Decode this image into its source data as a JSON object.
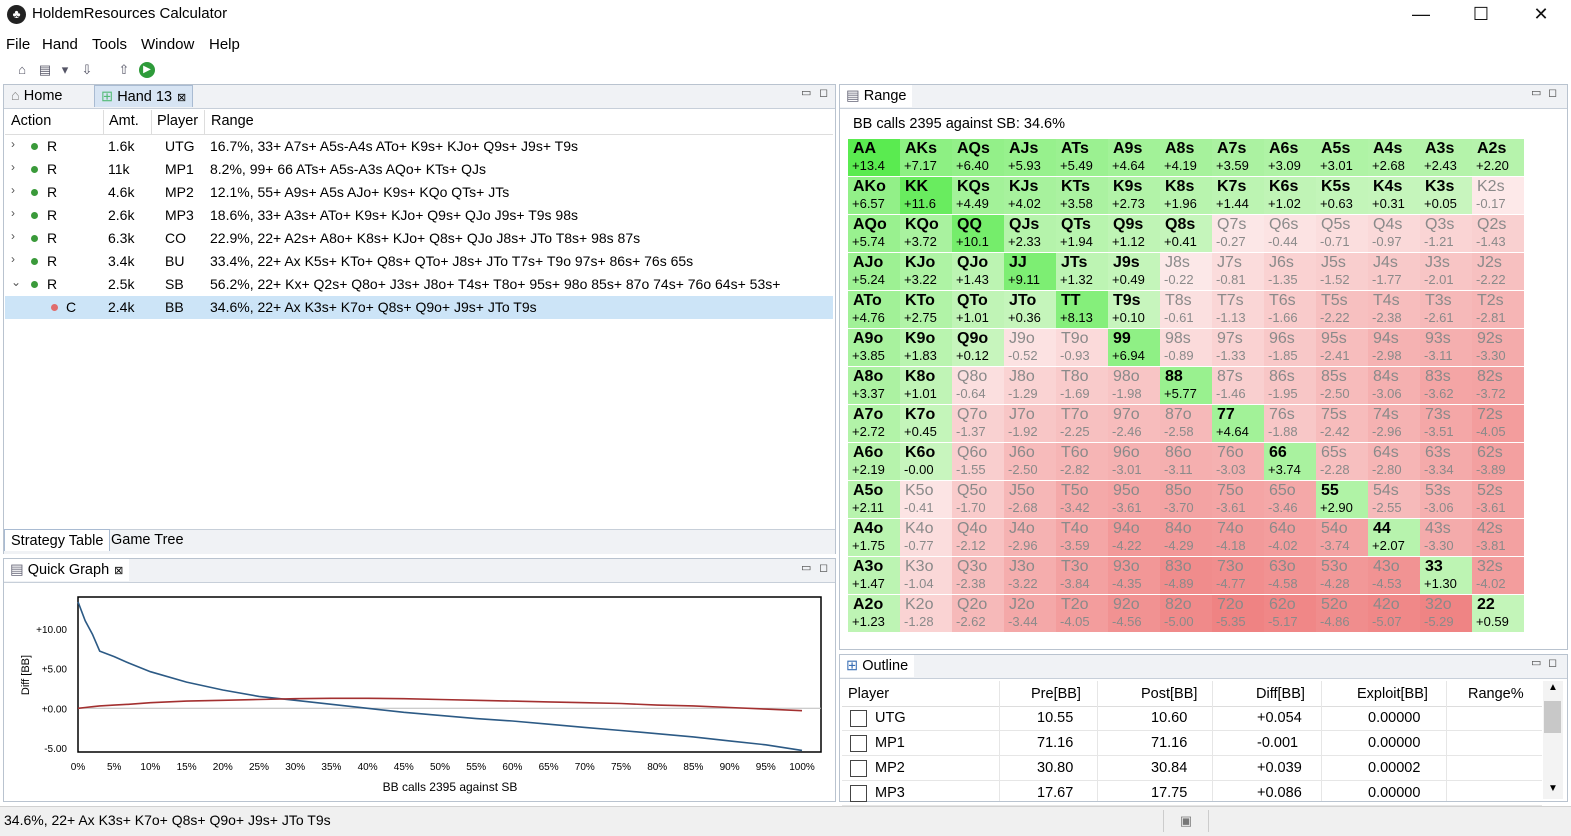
{
  "window": {
    "title": "HoldemResources Calculator"
  },
  "menu": [
    "File",
    "Hand",
    "Tools",
    "Window",
    "Help"
  ],
  "tabs": {
    "home": "Home",
    "hand": "Hand 13"
  },
  "strategy": {
    "columns": [
      "Action",
      "Amt.",
      "Player",
      "Range"
    ],
    "rows": [
      {
        "action": "R",
        "amt": "1.6k",
        "player": "UTG",
        "range": "16.7%, 33+ A7s+ A5s-A4s ATo+ K9s+ KJo+ Q9s+ J9s+ T9s"
      },
      {
        "action": "R",
        "amt": "11k",
        "player": "MP1",
        "range": "8.2%, 99+ 66 ATs+ A5s-A3s AQo+ KTs+ QJs"
      },
      {
        "action": "R",
        "amt": "4.6k",
        "player": "MP2",
        "range": "12.1%, 55+ A9s+ A5s AJo+ K9s+ KQo QTs+ JTs"
      },
      {
        "action": "R",
        "amt": "2.6k",
        "player": "MP3",
        "range": "18.6%, 33+ A3s+ ATo+ K9s+ KJo+ Q9s+ QJo J9s+ T9s 98s"
      },
      {
        "action": "R",
        "amt": "6.3k",
        "player": "CO",
        "range": "22.9%, 22+ A2s+ A8o+ K8s+ KJo+ Q8s+ QJo J8s+ JTo T8s+ 98s 87s"
      },
      {
        "action": "R",
        "amt": "3.4k",
        "player": "BU",
        "range": "33.4%, 22+ Ax K5s+ KTo+ Q8s+ QTo+ J8s+ JTo T7s+ T9o 97s+ 86s+ 76s 65s"
      },
      {
        "action": "R",
        "amt": "2.5k",
        "player": "SB",
        "range": "56.2%, 22+ Kx+ Q2s+ Q8o+ J3s+ J8o+ T4s+ T8o+ 95s+ 98o 85s+ 87o 74s+ 76o 64s+ 53s+"
      },
      {
        "action": "C",
        "amt": "2.4k",
        "player": "BB",
        "range": "34.6%, 22+ Ax K3s+ K7o+ Q8s+ Q9o+ J9s+ JTo T9s"
      }
    ],
    "bottom_tabs": [
      "Strategy Table",
      "Game Tree"
    ]
  },
  "quick_graph": {
    "tab_label": "Quick Graph",
    "ylabel": "Diff [BB]",
    "xlabel": "BB calls 2395 against SB",
    "y_ticks": [
      "+10.00",
      "+5.00",
      "+0.00",
      "-5.00"
    ],
    "x_ticks": [
      "0%",
      "5%",
      "10%",
      "15%",
      "20%",
      "25%",
      "30%",
      "35%",
      "40%",
      "45%",
      "50%",
      "55%",
      "60%",
      "65%",
      "70%",
      "75%",
      "80%",
      "85%",
      "90%",
      "95%",
      "100%"
    ]
  },
  "chart_data": {
    "type": "line",
    "xlabel": "BB calls 2395 against SB",
    "ylabel": "Diff [BB]",
    "x": [
      0,
      1,
      2,
      3,
      5,
      7,
      10,
      15,
      20,
      25,
      30,
      35,
      40,
      45,
      50,
      55,
      60,
      65,
      70,
      75,
      80,
      85,
      90,
      95,
      100
    ],
    "series": [
      {
        "color": "#2c5a85",
        "values": [
          13.4,
          11.0,
          9.3,
          7.2,
          6.5,
          5.7,
          4.6,
          3.3,
          2.3,
          1.5,
          1.0,
          0.5,
          0.0,
          -0.5,
          -0.9,
          -1.3,
          -1.6,
          -2.0,
          -2.4,
          -2.8,
          -3.2,
          -3.6,
          -4.1,
          -4.6,
          -5.3
        ]
      },
      {
        "color": "#a33030",
        "values": [
          0.0,
          0.1,
          0.2,
          0.3,
          0.4,
          0.5,
          0.7,
          0.9,
          1.0,
          1.1,
          1.2,
          1.25,
          1.25,
          1.2,
          1.1,
          1.0,
          0.9,
          0.8,
          0.7,
          0.6,
          0.4,
          0.3,
          0.1,
          -0.1,
          -0.3
        ]
      }
    ],
    "ylim": [
      -5.5,
      14
    ],
    "xlim": [
      0,
      100
    ]
  },
  "range_panel": {
    "tab_label": "Range",
    "title": "BB calls 2395 against SB: 34.6%",
    "grid": [
      [
        [
          "AA",
          "+13.4"
        ],
        [
          "AKs",
          "+7.17"
        ],
        [
          "AQs",
          "+6.40"
        ],
        [
          "AJs",
          "+5.93"
        ],
        [
          "ATs",
          "+5.49"
        ],
        [
          "A9s",
          "+4.64"
        ],
        [
          "A8s",
          "+4.19"
        ],
        [
          "A7s",
          "+3.59"
        ],
        [
          "A6s",
          "+3.09"
        ],
        [
          "A5s",
          "+3.01"
        ],
        [
          "A4s",
          "+2.68"
        ],
        [
          "A3s",
          "+2.43"
        ],
        [
          "A2s",
          "+2.20"
        ]
      ],
      [
        [
          "AKo",
          "+6.57"
        ],
        [
          "KK",
          "+11.6"
        ],
        [
          "KQs",
          "+4.49"
        ],
        [
          "KJs",
          "+4.02"
        ],
        [
          "KTs",
          "+3.58"
        ],
        [
          "K9s",
          "+2.73"
        ],
        [
          "K8s",
          "+1.96"
        ],
        [
          "K7s",
          "+1.44"
        ],
        [
          "K6s",
          "+1.02"
        ],
        [
          "K5s",
          "+0.63"
        ],
        [
          "K4s",
          "+0.31"
        ],
        [
          "K3s",
          "+0.05"
        ],
        [
          "K2s",
          "-0.17"
        ]
      ],
      [
        [
          "AQo",
          "+5.74"
        ],
        [
          "KQo",
          "+3.72"
        ],
        [
          "QQ",
          "+10.1"
        ],
        [
          "QJs",
          "+2.33"
        ],
        [
          "QTs",
          "+1.94"
        ],
        [
          "Q9s",
          "+1.12"
        ],
        [
          "Q8s",
          "+0.41"
        ],
        [
          "Q7s",
          "-0.27"
        ],
        [
          "Q6s",
          "-0.44"
        ],
        [
          "Q5s",
          "-0.71"
        ],
        [
          "Q4s",
          "-0.97"
        ],
        [
          "Q3s",
          "-1.21"
        ],
        [
          "Q2s",
          "-1.43"
        ]
      ],
      [
        [
          "AJo",
          "+5.24"
        ],
        [
          "KJo",
          "+3.22"
        ],
        [
          "QJo",
          "+1.43"
        ],
        [
          "JJ",
          "+9.11"
        ],
        [
          "JTs",
          "+1.32"
        ],
        [
          "J9s",
          "+0.49"
        ],
        [
          "J8s",
          "-0.22"
        ],
        [
          "J7s",
          "-0.81"
        ],
        [
          "J6s",
          "-1.35"
        ],
        [
          "J5s",
          "-1.52"
        ],
        [
          "J4s",
          "-1.77"
        ],
        [
          "J3s",
          "-2.01"
        ],
        [
          "J2s",
          "-2.22"
        ]
      ],
      [
        [
          "ATo",
          "+4.76"
        ],
        [
          "KTo",
          "+2.75"
        ],
        [
          "QTo",
          "+1.01"
        ],
        [
          "JTo",
          "+0.36"
        ],
        [
          "TT",
          "+8.13"
        ],
        [
          "T9s",
          "+0.10"
        ],
        [
          "T8s",
          "-0.61"
        ],
        [
          "T7s",
          "-1.13"
        ],
        [
          "T6s",
          "-1.66"
        ],
        [
          "T5s",
          "-2.22"
        ],
        [
          "T4s",
          "-2.38"
        ],
        [
          "T3s",
          "-2.61"
        ],
        [
          "T2s",
          "-2.81"
        ]
      ],
      [
        [
          "A9o",
          "+3.85"
        ],
        [
          "K9o",
          "+1.83"
        ],
        [
          "Q9o",
          "+0.12"
        ],
        [
          "J9o",
          "-0.52"
        ],
        [
          "T9o",
          "-0.93"
        ],
        [
          "99",
          "+6.94"
        ],
        [
          "98s",
          "-0.89"
        ],
        [
          "97s",
          "-1.33"
        ],
        [
          "96s",
          "-1.85"
        ],
        [
          "95s",
          "-2.41"
        ],
        [
          "94s",
          "-2.98"
        ],
        [
          "93s",
          "-3.11"
        ],
        [
          "92s",
          "-3.30"
        ]
      ],
      [
        [
          "A8o",
          "+3.37"
        ],
        [
          "K8o",
          "+1.01"
        ],
        [
          "Q8o",
          "-0.64"
        ],
        [
          "J8o",
          "-1.29"
        ],
        [
          "T8o",
          "-1.69"
        ],
        [
          "98o",
          "-1.98"
        ],
        [
          "88",
          "+5.77"
        ],
        [
          "87s",
          "-1.46"
        ],
        [
          "86s",
          "-1.95"
        ],
        [
          "85s",
          "-2.50"
        ],
        [
          "84s",
          "-3.06"
        ],
        [
          "83s",
          "-3.62"
        ],
        [
          "82s",
          "-3.72"
        ]
      ],
      [
        [
          "A7o",
          "+2.72"
        ],
        [
          "K7o",
          "+0.45"
        ],
        [
          "Q7o",
          "-1.37"
        ],
        [
          "J7o",
          "-1.92"
        ],
        [
          "T7o",
          "-2.25"
        ],
        [
          "97o",
          "-2.46"
        ],
        [
          "87o",
          "-2.58"
        ],
        [
          "77",
          "+4.64"
        ],
        [
          "76s",
          "-1.88"
        ],
        [
          "75s",
          "-2.42"
        ],
        [
          "74s",
          "-2.96"
        ],
        [
          "73s",
          "-3.51"
        ],
        [
          "72s",
          "-4.05"
        ]
      ],
      [
        [
          "A6o",
          "+2.19"
        ],
        [
          "K6o",
          "-0.00"
        ],
        [
          "Q6o",
          "-1.55"
        ],
        [
          "J6o",
          "-2.50"
        ],
        [
          "T6o",
          "-2.82"
        ],
        [
          "96o",
          "-3.01"
        ],
        [
          "86o",
          "-3.11"
        ],
        [
          "76o",
          "-3.03"
        ],
        [
          "66",
          "+3.74"
        ],
        [
          "65s",
          "-2.28"
        ],
        [
          "64s",
          "-2.80"
        ],
        [
          "63s",
          "-3.34"
        ],
        [
          "62s",
          "-3.89"
        ]
      ],
      [
        [
          "A5o",
          "+2.11"
        ],
        [
          "K5o",
          "-0.41"
        ],
        [
          "Q5o",
          "-1.70"
        ],
        [
          "J5o",
          "-2.68"
        ],
        [
          "T5o",
          "-3.42"
        ],
        [
          "95o",
          "-3.61"
        ],
        [
          "85o",
          "-3.70"
        ],
        [
          "75o",
          "-3.61"
        ],
        [
          "65o",
          "-3.46"
        ],
        [
          "55",
          "+2.90"
        ],
        [
          "54s",
          "-2.55"
        ],
        [
          "53s",
          "-3.06"
        ],
        [
          "52s",
          "-3.61"
        ]
      ],
      [
        [
          "A4o",
          "+1.75"
        ],
        [
          "K4o",
          "-0.77"
        ],
        [
          "Q4o",
          "-2.12"
        ],
        [
          "J4o",
          "-2.96"
        ],
        [
          "T4o",
          "-3.59"
        ],
        [
          "94o",
          "-4.22"
        ],
        [
          "84o",
          "-4.29"
        ],
        [
          "74o",
          "-4.18"
        ],
        [
          "64o",
          "-4.02"
        ],
        [
          "54o",
          "-3.74"
        ],
        [
          "44",
          "+2.07"
        ],
        [
          "43s",
          "-3.30"
        ],
        [
          "42s",
          "-3.81"
        ]
      ],
      [
        [
          "A3o",
          "+1.47"
        ],
        [
          "K3o",
          "-1.04"
        ],
        [
          "Q3o",
          "-2.38"
        ],
        [
          "J3o",
          "-3.22"
        ],
        [
          "T3o",
          "-3.84"
        ],
        [
          "93o",
          "-4.35"
        ],
        [
          "83o",
          "-4.89"
        ],
        [
          "73o",
          "-4.77"
        ],
        [
          "63o",
          "-4.58"
        ],
        [
          "53o",
          "-4.28"
        ],
        [
          "43o",
          "-4.53"
        ],
        [
          "33",
          "+1.30"
        ],
        [
          "32s",
          "-4.02"
        ]
      ],
      [
        [
          "A2o",
          "+1.23"
        ],
        [
          "K2o",
          "-1.28"
        ],
        [
          "Q2o",
          "-2.62"
        ],
        [
          "J2o",
          "-3.44"
        ],
        [
          "T2o",
          "-4.05"
        ],
        [
          "92o",
          "-4.56"
        ],
        [
          "82o",
          "-5.00"
        ],
        [
          "72o",
          "-5.35"
        ],
        [
          "62o",
          "-5.17"
        ],
        [
          "52o",
          "-4.86"
        ],
        [
          "42o",
          "-5.07"
        ],
        [
          "32o",
          "-5.29"
        ],
        [
          "22",
          "+0.59"
        ]
      ]
    ],
    "in_range": [
      [
        1,
        1,
        1,
        1,
        1,
        1,
        1,
        1,
        1,
        1,
        1,
        1,
        1
      ],
      [
        1,
        1,
        1,
        1,
        1,
        1,
        1,
        1,
        1,
        1,
        1,
        1,
        0
      ],
      [
        1,
        1,
        1,
        1,
        1,
        1,
        1,
        0,
        0,
        0,
        0,
        0,
        0
      ],
      [
        1,
        1,
        1,
        1,
        1,
        1,
        0,
        0,
        0,
        0,
        0,
        0,
        0
      ],
      [
        1,
        1,
        1,
        1,
        1,
        1,
        0,
        0,
        0,
        0,
        0,
        0,
        0
      ],
      [
        1,
        1,
        1,
        0,
        0,
        1,
        0,
        0,
        0,
        0,
        0,
        0,
        0
      ],
      [
        1,
        1,
        0,
        0,
        0,
        0,
        1,
        0,
        0,
        0,
        0,
        0,
        0
      ],
      [
        1,
        1,
        0,
        0,
        0,
        0,
        0,
        1,
        0,
        0,
        0,
        0,
        0
      ],
      [
        1,
        1,
        0,
        0,
        0,
        0,
        0,
        0,
        1,
        0,
        0,
        0,
        0
      ],
      [
        1,
        0,
        0,
        0,
        0,
        0,
        0,
        0,
        0,
        1,
        0,
        0,
        0
      ],
      [
        1,
        0,
        0,
        0,
        0,
        0,
        0,
        0,
        0,
        0,
        1,
        0,
        0
      ],
      [
        1,
        0,
        0,
        0,
        0,
        0,
        0,
        0,
        0,
        0,
        0,
        1,
        0
      ],
      [
        1,
        0,
        0,
        0,
        0,
        0,
        0,
        0,
        0,
        0,
        0,
        0,
        1
      ]
    ]
  },
  "outline": {
    "tab_label": "Outline",
    "columns": [
      "Player",
      "Pre[BB]",
      "Post[BB]",
      "Diff[BB]",
      "Exploit[BB]",
      "Range%"
    ],
    "rows": [
      {
        "player": "UTG",
        "pre": "10.55",
        "post": "10.60",
        "diff": "+0.054",
        "exploit": "0.00000"
      },
      {
        "player": "MP1",
        "pre": "71.16",
        "post": "71.16",
        "diff": "-0.001",
        "exploit": "0.00000"
      },
      {
        "player": "MP2",
        "pre": "30.80",
        "post": "30.84",
        "diff": "+0.039",
        "exploit": "0.00002"
      },
      {
        "player": "MP3",
        "pre": "17.67",
        "post": "17.75",
        "diff": "+0.086",
        "exploit": "0.00000"
      }
    ]
  },
  "status": {
    "text": "34.6%, 22+ Ax K3s+ K7o+ Q8s+ Q9o+ J9s+ JTo T9s"
  }
}
